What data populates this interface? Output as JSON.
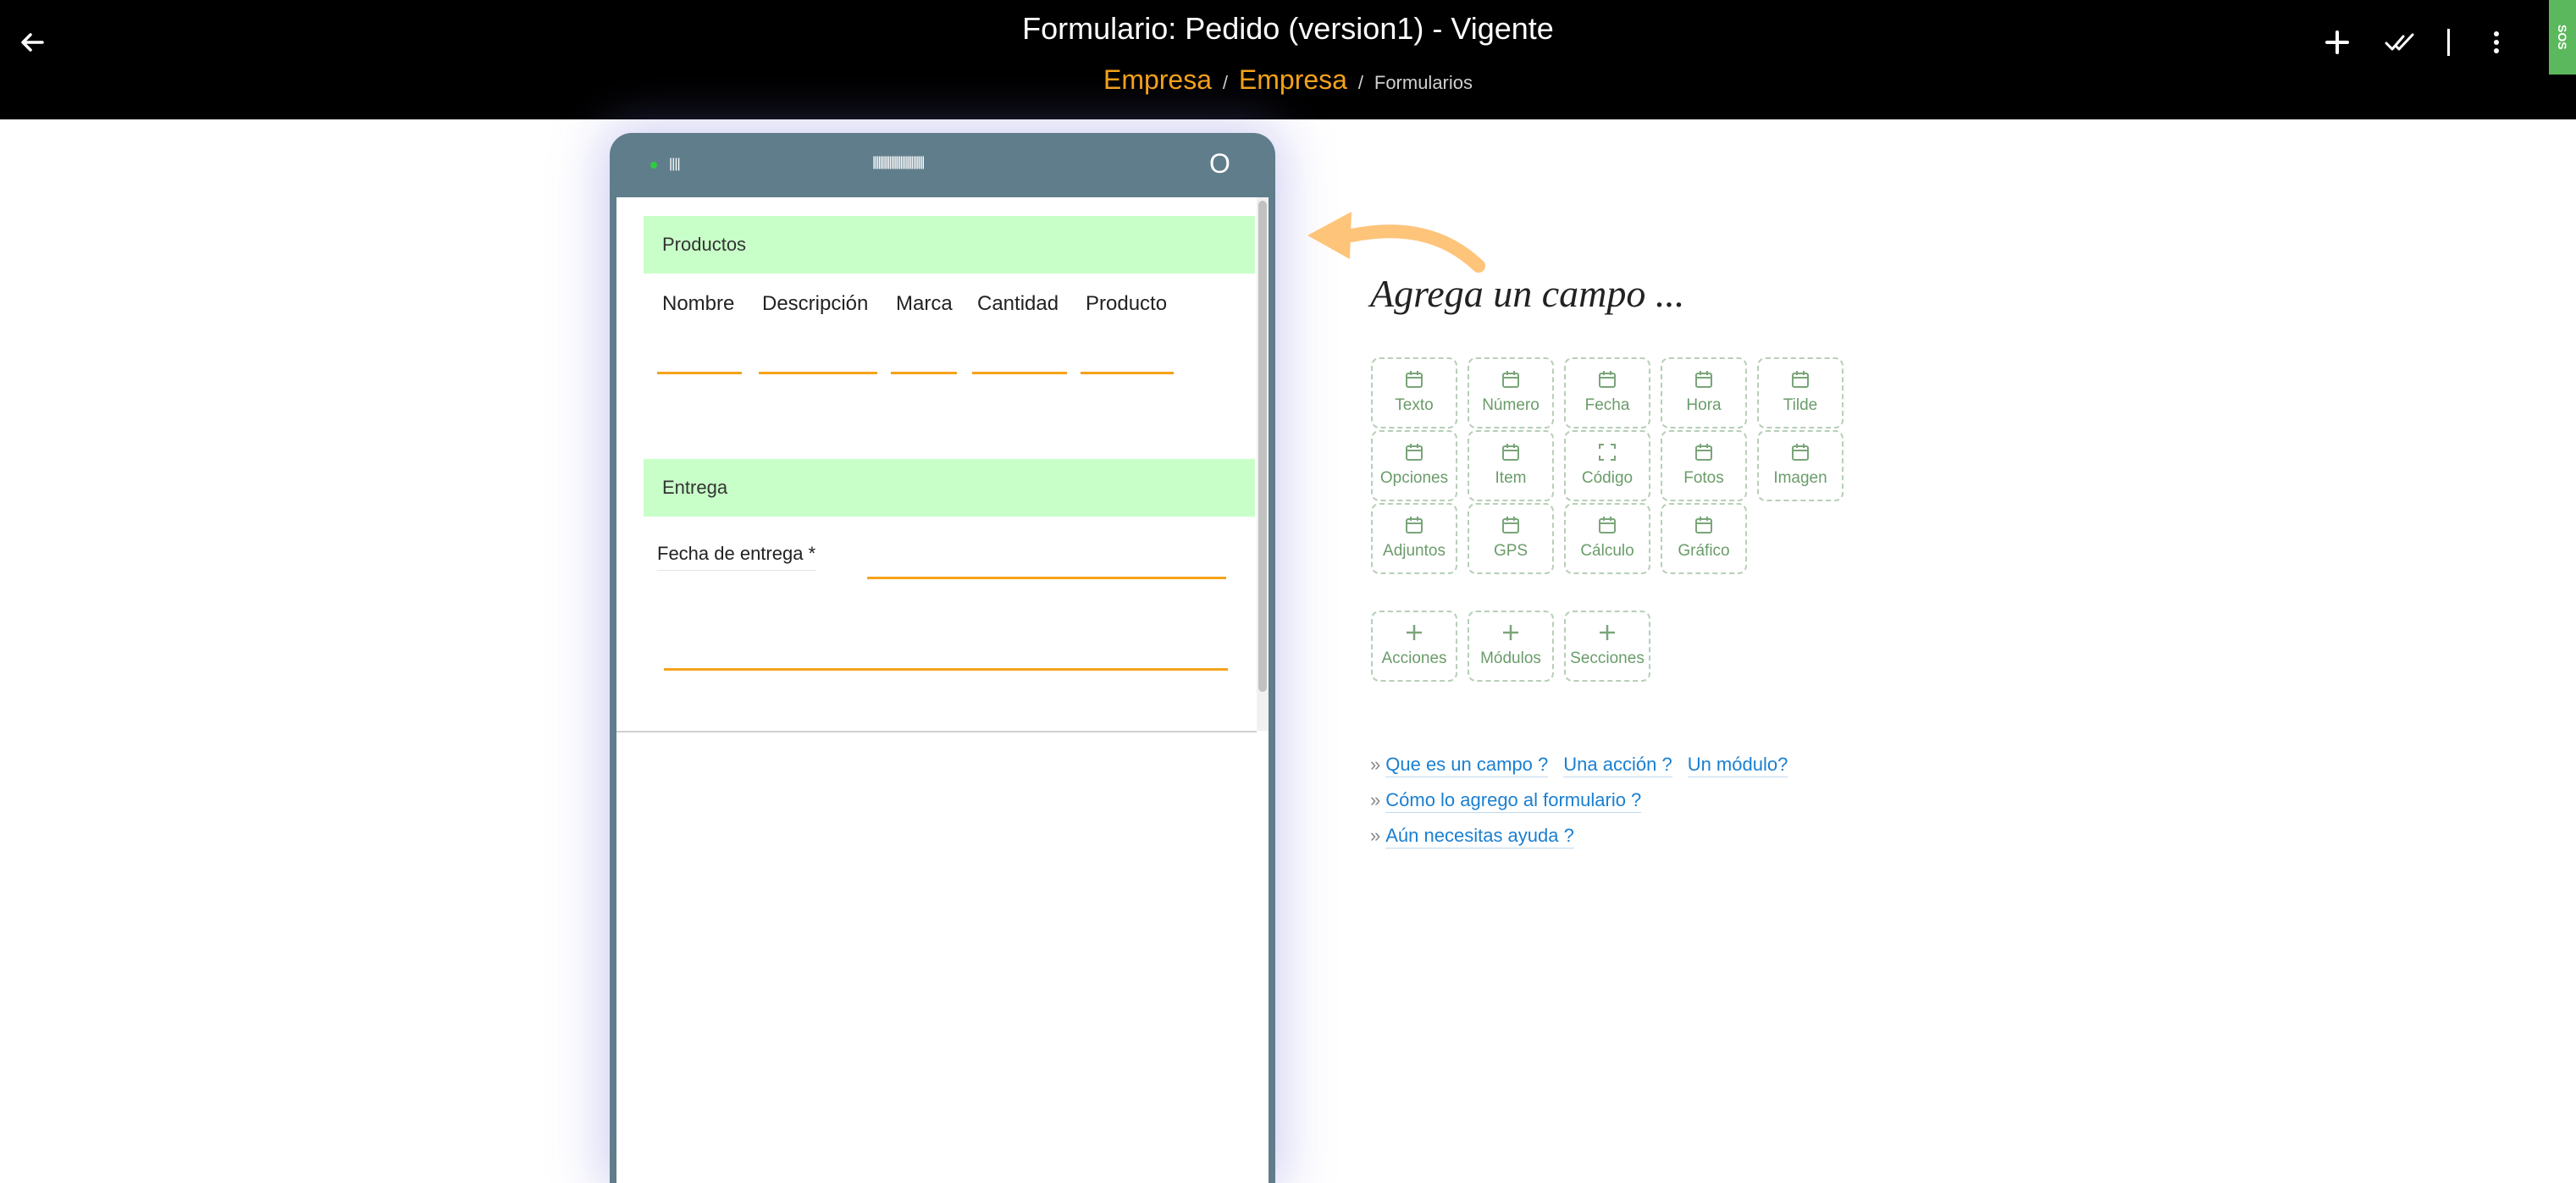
{
  "header": {
    "title": "Formulario: Pedido (version1) - Vigente",
    "breadcrumb": {
      "link1": "Empresa",
      "link2": "Empresa",
      "current": "Formularios",
      "separator": "/"
    },
    "sos_label": "SOS",
    "icons": [
      "back-arrow-icon",
      "plus-icon",
      "double-check-icon",
      "more-vertical-icon"
    ]
  },
  "phone": {
    "status_signal": "||||",
    "status_bars": "||||||||||||||||||||||||||||",
    "status_circle": "O",
    "sections": [
      {
        "label": "Productos",
        "columns": [
          "Nombre",
          "Descripción",
          "Marca",
          "Cantidad",
          "Producto"
        ]
      },
      {
        "label": "Entrega",
        "field_label": "Fecha de entrega *"
      }
    ]
  },
  "panel": {
    "heading": "Agrega un campo ...",
    "field_types": [
      "Texto",
      "Número",
      "Fecha",
      "Hora",
      "Tilde",
      "Opciones",
      "Item",
      "Código",
      "Fotos",
      "Imagen",
      "Adjuntos",
      "GPS",
      "Cálculo",
      "Gráfico"
    ],
    "add_types": [
      "Acciones",
      "Módulos",
      "Secciones"
    ],
    "help": {
      "line1": [
        "Que es un campo ?",
        "Una acción ?",
        "Un módulo?"
      ],
      "line2": "Cómo lo agrego al formulario ?",
      "line3": "Aún necesitas ayuda ?",
      "bullet": "»"
    }
  },
  "colors": {
    "accent_orange": "#f5a21a",
    "section_green": "#c8ffc8",
    "phone_body": "#607d8b",
    "tile_text": "#6a9c6a",
    "link_blue": "#1a7fd1",
    "sos_green": "#5cb85c"
  }
}
